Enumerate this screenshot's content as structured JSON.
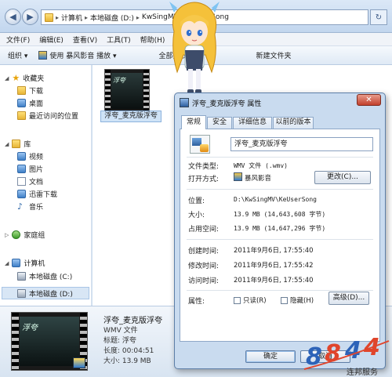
{
  "address": {
    "path": [
      "计算机",
      "本地磁盘 (D:)",
      "KwSingMV",
      "KeUserSong"
    ]
  },
  "menu": [
    "文件(F)",
    "编辑(E)",
    "查看(V)",
    "工具(T)",
    "帮助(H)"
  ],
  "toolbar": {
    "organize": "组织 ▾",
    "play_with": "使用 暴风影音 播放 ▾",
    "play_all": "全部播放",
    "new_folder": "新建文件夹"
  },
  "nav": {
    "favorites": "收藏夹",
    "downloads": "下载",
    "desktop": "桌面",
    "recent": "最近访问的位置",
    "libraries": "库",
    "videos": "视频",
    "pictures": "图片",
    "documents": "文档",
    "thunder": "迅雷下载",
    "music": "音乐",
    "homegroup": "家庭组",
    "computer": "计算机",
    "drive_c": "本地磁盘 (C:)",
    "drive_d": "本地磁盘 (D:)"
  },
  "file": {
    "name": "浮夸_麦克版浮夸",
    "thumb_text": "浮夸"
  },
  "details": {
    "name": "浮夸_麦克版浮夸",
    "type": "WMV 文件",
    "title": "标题: 浮夸",
    "length": "长度: 00:04:51",
    "size": "大小: 13.9 MB"
  },
  "props": {
    "title": "浮夸_麦克版浮夸 属性",
    "close": "✕",
    "tabs": [
      "常规",
      "安全",
      "详细信息",
      "以前的版本"
    ],
    "name_value": "浮夸_麦克版浮夸",
    "labels": {
      "file_type": "文件类型:",
      "opens_with": "打开方式:",
      "location": "位置:",
      "size": "大小:",
      "size_on_disk": "占用空间:",
      "created": "创建时间:",
      "modified": "修改时间:",
      "accessed": "访问时间:",
      "attributes": "属性:"
    },
    "values": {
      "file_type": "WMV 文件 (.wmv)",
      "opens_with": "暴风影音",
      "location": "D:\\KwSingMV\\KeUserSong",
      "size": "13.9 MB (14,643,608 字节)",
      "size_on_disk": "13.9 MB (14,647,296 字节)",
      "created": "2011年9月6日, 17:55:40",
      "modified": "2011年9月6日, 17:55:42",
      "accessed": "2011年9月6日, 17:55:40"
    },
    "change_btn": "更改(C)...",
    "readonly": "只读(R)",
    "hidden": "隐藏(H)",
    "advanced_btn": "高级(D)...",
    "ok": "确定",
    "cancel": "取消"
  },
  "watermark": {
    "text": "连邦服务"
  }
}
